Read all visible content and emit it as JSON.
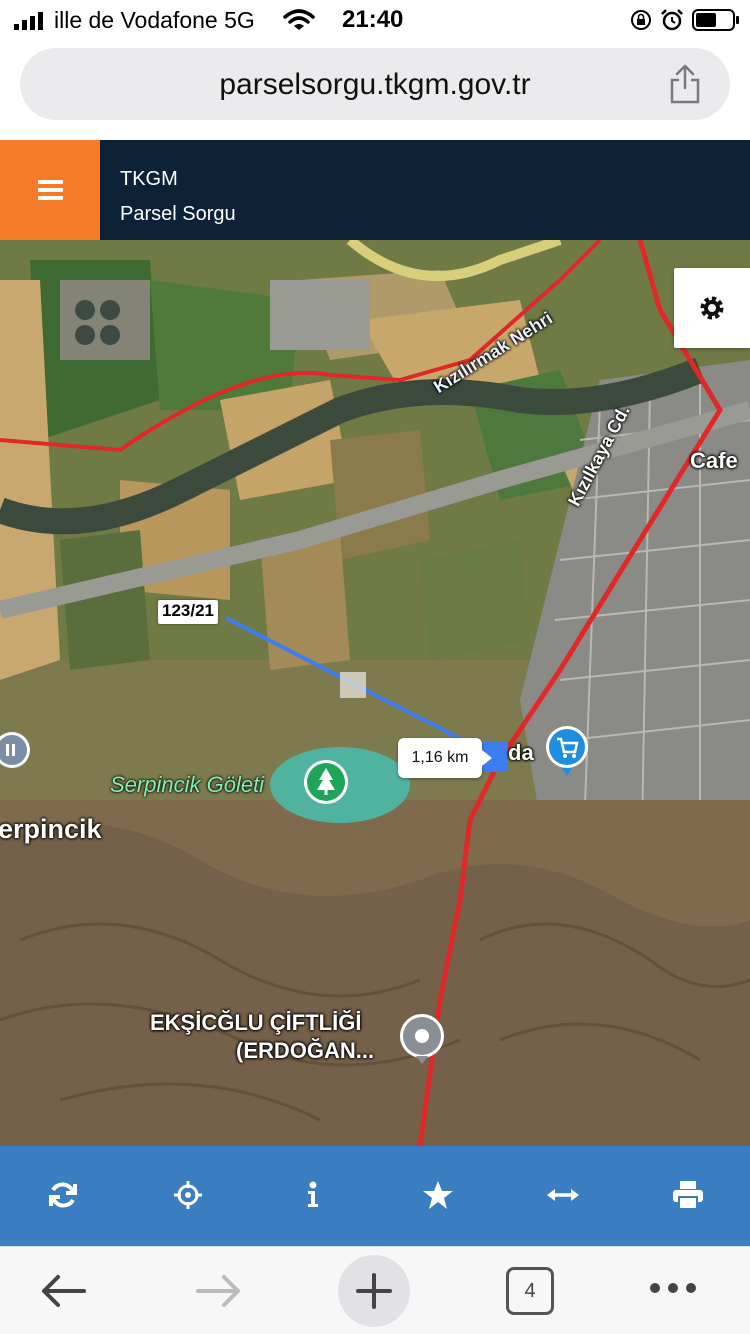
{
  "status_bar": {
    "carrier": "ille de Vodafone 5G",
    "time": "21:40",
    "icons": [
      "signal-icon",
      "wifi-icon",
      "orientation-lock-icon",
      "alarm-icon",
      "battery-icon"
    ]
  },
  "browser": {
    "url": "parselsorgu.tkgm.gov.tr",
    "open_tabs": "4",
    "icons": [
      "share-icon",
      "back-arrow-icon",
      "forward-arrow-icon",
      "plus-icon",
      "more-icon"
    ]
  },
  "app_header": {
    "brand": "TKGM",
    "subtitle": "Parsel Sorgu",
    "menu_icon": "hamburger-icon"
  },
  "map": {
    "parcel_label": "123/21",
    "distance_label": "1,16 km",
    "labels": {
      "pond": "Serpincik Göleti",
      "village": "erpincik",
      "farm_line1": "EKŞİCĞLU ÇİFTLİĞİ",
      "farm_line2": "(ERDOĞAN...",
      "place": "da",
      "road": "Kızılkaya Cd.",
      "cafe": "Cafe",
      "river": "Kızılırmak Nehri"
    },
    "colors": {
      "measure_line": "#3d7df0",
      "boundary": "#e02828",
      "pond": "#4fb3a0"
    }
  },
  "toolbar": {
    "tools": [
      "refresh-icon",
      "locate-icon",
      "info-icon",
      "star-icon",
      "measure-icon",
      "print-icon"
    ]
  },
  "colors": {
    "header_bg": "#0d2137",
    "menu_bg": "#f47b2a",
    "toolbar_bg": "#3a7dc0"
  }
}
